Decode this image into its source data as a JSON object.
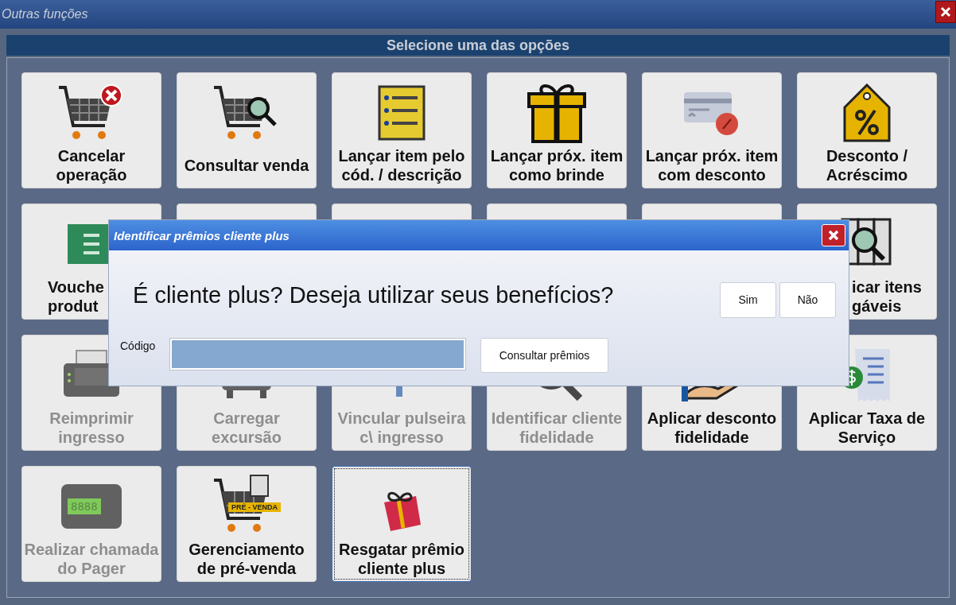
{
  "window": {
    "title": "Outras funções"
  },
  "header": "Selecione uma das opções",
  "tiles": [
    {
      "label": "Cancelar operação",
      "kind": "normal",
      "disabled": false,
      "selected": false
    },
    {
      "label": "Consultar venda",
      "kind": "normal",
      "disabled": false,
      "selected": false
    },
    {
      "label": "Lançar item pelo cód. / descrição",
      "kind": "normal",
      "disabled": false,
      "selected": false
    },
    {
      "label": "Lançar próx. item como brinde",
      "kind": "normal",
      "disabled": false,
      "selected": false
    },
    {
      "label": "Lançar próx. item com desconto",
      "kind": "normal",
      "disabled": false,
      "selected": false
    },
    {
      "label": "Desconto / Acréscimo",
      "kind": "normal",
      "disabled": false,
      "selected": false
    },
    {
      "label": "Vouche produt",
      "kind": "covered-left",
      "disabled": false,
      "selected": false
    },
    {
      "kind": "covered",
      "selected": false
    },
    {
      "kind": "covered",
      "selected": false
    },
    {
      "kind": "covered",
      "selected": false
    },
    {
      "kind": "covered",
      "selected": false
    },
    {
      "label": "icar itens gáveis",
      "kind": "covered-right",
      "disabled": false,
      "selected": false
    },
    {
      "label": "Reimprimir ingresso",
      "kind": "normal",
      "disabled": true,
      "selected": false
    },
    {
      "label": "Carregar excursão",
      "kind": "normal",
      "disabled": true,
      "selected": false
    },
    {
      "label": "Vincular pulseira c\\ ingresso",
      "kind": "normal",
      "disabled": true,
      "selected": false
    },
    {
      "label": "Identificar cliente fidelidade",
      "kind": "normal",
      "disabled": true,
      "selected": false
    },
    {
      "label": "Aplicar desconto fidelidade",
      "kind": "normal",
      "disabled": false,
      "selected": false
    },
    {
      "label": "Aplicar Taxa de Serviço",
      "kind": "normal",
      "disabled": false,
      "selected": false
    },
    {
      "label": "Realizar chamada do Pager",
      "kind": "normal",
      "disabled": true,
      "selected": false,
      "icon_text": "8888"
    },
    {
      "label": "Gerenciamento de pré-venda",
      "kind": "normal",
      "disabled": false,
      "selected": false,
      "icon_text": "PRÉ - VENDA"
    },
    {
      "label": "Resgatar prêmio cliente plus",
      "kind": "normal",
      "disabled": false,
      "selected": true
    }
  ],
  "dialog": {
    "title": "Identificar prêmios cliente plus",
    "question": "É cliente plus? Deseja utilizar seus benefícios?",
    "yes_button": "Sim",
    "no_button": "Não",
    "code_label": "Código",
    "lookup_button": "Consultar prêmios"
  }
}
